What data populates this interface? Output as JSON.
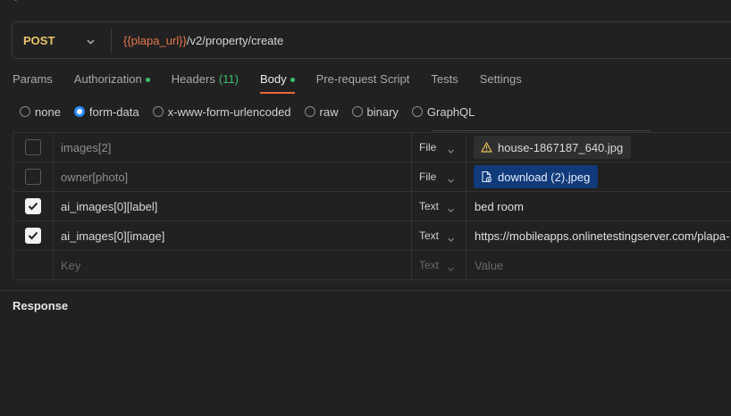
{
  "request": {
    "method": "POST",
    "url_variable": "{{plapa_url}}",
    "url_path": "/v2/property/create"
  },
  "tabs": [
    {
      "label": "Params",
      "dot": false,
      "count": ""
    },
    {
      "label": "Authorization",
      "dot": true,
      "count": ""
    },
    {
      "label": "Headers",
      "dot": false,
      "count": "(11)"
    },
    {
      "label": "Body",
      "dot": true,
      "count": "",
      "active": true
    },
    {
      "label": "Pre-request Script",
      "dot": false,
      "count": ""
    },
    {
      "label": "Tests",
      "dot": false,
      "count": ""
    },
    {
      "label": "Settings",
      "dot": false,
      "count": ""
    }
  ],
  "body_types": [
    {
      "label": "none",
      "selected": false
    },
    {
      "label": "form-data",
      "selected": true
    },
    {
      "label": "x-www-form-urlencoded",
      "selected": false
    },
    {
      "label": "raw",
      "selected": false
    },
    {
      "label": "binary",
      "selected": false
    },
    {
      "label": "GraphQL",
      "selected": false
    }
  ],
  "form_rows": [
    {
      "checked": false,
      "key": "images[2]",
      "type": "File",
      "value": "house-1867187_640.jpg",
      "value_kind": "warning-file"
    },
    {
      "checked": false,
      "key": "owner[photo]",
      "type": "File",
      "value": "download (2).jpeg",
      "value_kind": "file"
    },
    {
      "checked": true,
      "key": "ai_images[0][label]",
      "type": "Text",
      "value": "bed room",
      "value_kind": "text"
    },
    {
      "checked": true,
      "key": "ai_images[0][image]",
      "type": "Text",
      "value": "https://mobileapps.onlinetestingserver.com/plapa-",
      "value_kind": "text"
    }
  ],
  "placeholder_row": {
    "key": "Key",
    "type": "Text",
    "value": "Value"
  },
  "response_label": "Response",
  "colors": {
    "accent": "#e9663a",
    "method": "#e9c46a",
    "variable": "#e5774a",
    "status_dot": "#3dbe6c",
    "radio": "#2e8bff"
  }
}
